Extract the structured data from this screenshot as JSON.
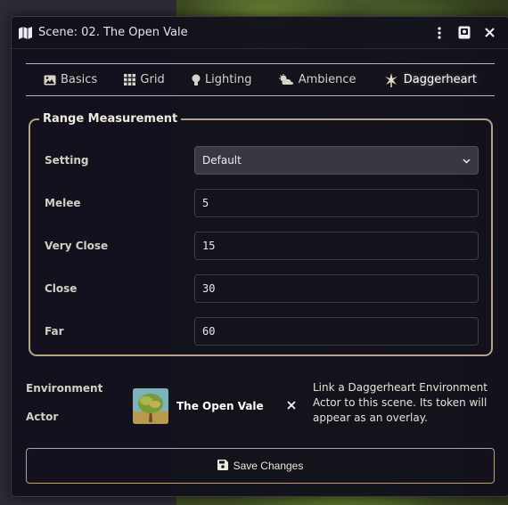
{
  "window": {
    "title": "Scene: 02. The Open Vale",
    "controls": {
      "menu_icon": "kebab-menu-icon",
      "sheet_icon": "journal-book-icon",
      "close_icon": "close-icon"
    }
  },
  "tabs": [
    {
      "label": "Basics",
      "icon": "image-icon",
      "active": false
    },
    {
      "label": "Grid",
      "icon": "grid-icon",
      "active": false
    },
    {
      "label": "Lighting",
      "icon": "lightbulb-icon",
      "active": false
    },
    {
      "label": "Ambience",
      "icon": "cloud-sun-icon",
      "active": false
    },
    {
      "label": "Daggerheart",
      "icon": "daggerheart-logo-icon",
      "active": true
    }
  ],
  "range": {
    "legend": "Range Measurement",
    "setting_label": "Setting",
    "setting_value": "Default",
    "fields": [
      {
        "label": "Melee",
        "value": "5"
      },
      {
        "label": "Very Close",
        "value": "15"
      },
      {
        "label": "Close",
        "value": "30"
      },
      {
        "label": "Far",
        "value": "60"
      }
    ]
  },
  "environment": {
    "label_line1": "Environment",
    "label_line2": "Actor",
    "actor_name": "The Open Vale",
    "hint": "Link a Daggerheart Environment Actor to this scene. Its token will appear as an overlay."
  },
  "save_label": "Save Changes",
  "colors": {
    "accent_border": "#b3a389",
    "panel_bg": "#12111c",
    "text": "#e8e6ee"
  }
}
